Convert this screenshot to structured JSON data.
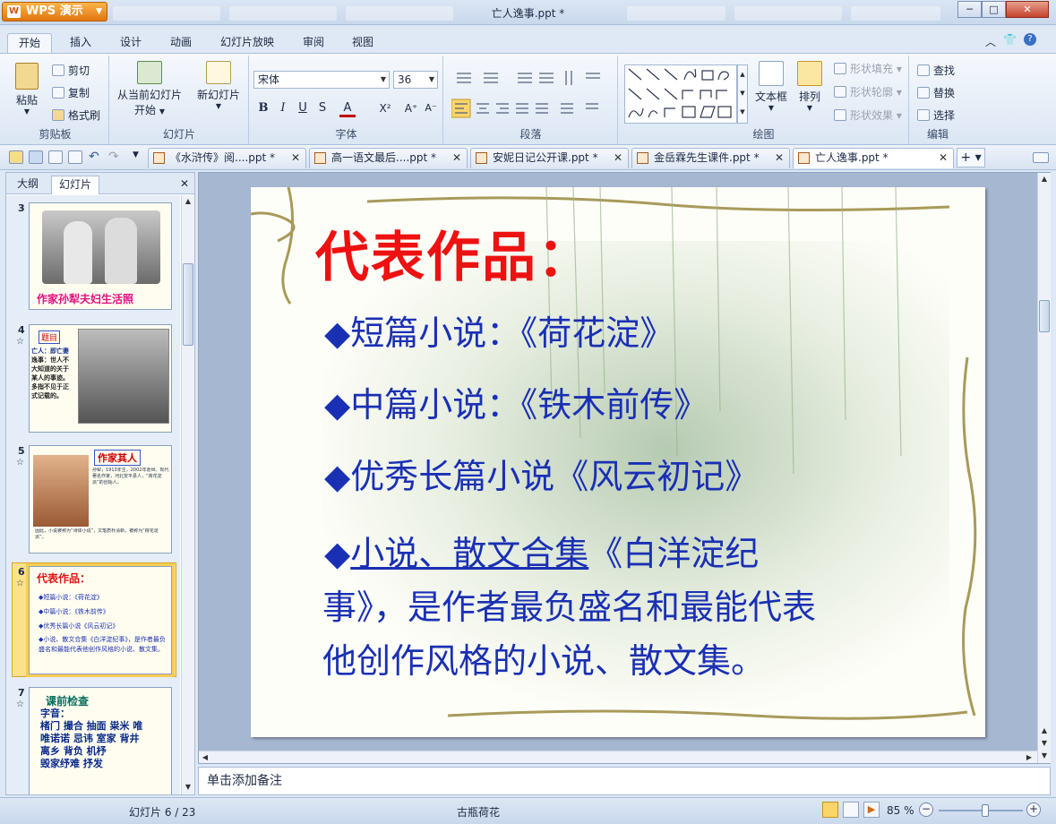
{
  "app": {
    "name": "WPS 演示",
    "title": "亡人逸事.ppt *"
  },
  "window": {
    "min": "─",
    "max": "□",
    "close": "✕"
  },
  "ribbon_tabs": [
    "开始",
    "插入",
    "设计",
    "动画",
    "幻灯片放映",
    "审阅",
    "视图"
  ],
  "ribbon_right_icons": {
    "collapse": "︿",
    "skin": "👕",
    "help": "?"
  },
  "groups": {
    "clipboard": {
      "label": "剪贴板",
      "paste": "粘贴",
      "cut": "剪切",
      "copy": "复制",
      "format": "格式刷"
    },
    "slides": {
      "label": "幻灯片",
      "from_current": "从当前幻灯片",
      "start": "开始",
      "new_slide": "新幻灯片"
    },
    "font": {
      "label": "字体",
      "font_name": "宋体",
      "font_size": "36",
      "bold": "B",
      "italic": "I",
      "underline": "U",
      "shadow": "S",
      "color": "A",
      "superscript": "X²",
      "grow": "A⁺",
      "shrink": "A⁻"
    },
    "paragraph": {
      "label": "段落"
    },
    "drawing": {
      "label": "绘图",
      "textbox": "文本框",
      "arrange": "排列",
      "shape_fill": "形状填充",
      "shape_outline": "形状轮廓",
      "shape_effects": "形状效果"
    },
    "edit": {
      "label": "编辑",
      "find": "查找",
      "replace": "替换",
      "select": "选择"
    }
  },
  "doc_tabs": [
    {
      "label": "《水浒传》阅....ppt *"
    },
    {
      "label": "高一语文最后....ppt *"
    },
    {
      "label": "安妮日记公开课.ppt *"
    },
    {
      "label": "金岳霖先生课件.ppt *"
    },
    {
      "label": "亡人逸事.ppt *"
    }
  ],
  "left_pane": {
    "tab_outline": "大纲",
    "tab_slides": "幻灯片",
    "close": "✕"
  },
  "thumbs": [
    {
      "num": "3",
      "caption": "作家孙犁夫妇生活照"
    },
    {
      "num": "4",
      "heading": "题目",
      "lines": [
        "亡人：即亡妻",
        "逸事：世人不大知道的关于某人的事迹。多指不见于正式记载的。"
      ]
    },
    {
      "num": "5",
      "heading": "作家其人",
      "lines": [
        "孙犁，1913年生，2002年逝世。现代著名作家，河北安平县人，“荷花淀派”的创始人。",
        "因此，小说被称为“诗体小说”，文笔质朴清新，被称为“荷花淀派”。"
      ]
    },
    {
      "num": "6",
      "heading": "代表作品：",
      "lines": [
        "◆短篇小说：《荷花淀》",
        "◆中篇小说：《铁木前传》",
        "◆优秀长篇小说《风云初记》",
        "◆小说、散文合集《白洋淀纪事》，是作者最负盛名和最能代表他创作风格的小说、散文集。"
      ]
    },
    {
      "num": "7",
      "heading": "课前检查",
      "lines": [
        "字音：",
        "楮门 撮合 抽面 粜米 唯",
        "唯诺诺 忌讳 室家 背井",
        "离乡 背负 机杼",
        "毁家纾难 抒发"
      ]
    }
  ],
  "slide": {
    "title": "代表作品：",
    "line1": "◆短篇小说：《荷花淀》",
    "line2": "◆中篇小说：《铁木前传》",
    "line3": "◆优秀长篇小说《风云初记》",
    "line4_bullet": "◆",
    "line4_underlined": "小说、散文合集",
    "line4_rest": "《白洋淀纪",
    "line5": "事》，是作者最负盛名和最能代表",
    "line6": "他创作风格的小说、散文集。"
  },
  "notes_placeholder": "单击添加备注",
  "status": {
    "slide_counter": "幻灯片 6 / 23",
    "theme": "古瓶荷花",
    "zoom": "85 %",
    "zoom_level": 0.55
  }
}
